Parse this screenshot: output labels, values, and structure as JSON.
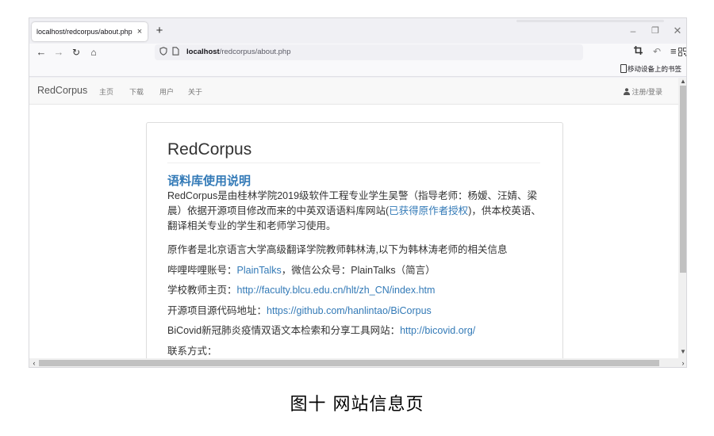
{
  "browser": {
    "tab_title": "localhost/redcorpus/about.php",
    "tab_close": "×",
    "new_tab": "+",
    "window_controls": {
      "minimize": "–",
      "maximize": "❐",
      "close": "✕"
    },
    "nav": {
      "back": "←",
      "forward": "→",
      "reload": "↻",
      "home": "⌂"
    },
    "url": {
      "host": "localhost",
      "path": "/redcorpus/about.php",
      "shield_icon": "shield-icon",
      "page_icon": "page-icon"
    },
    "toolbar_icons": {
      "qr": "qr-code-icon",
      "star": "star-icon",
      "crop": "crop-icon",
      "undo": "undo-icon",
      "menu": "menu-icon"
    },
    "bookmark_mobile": "移动设备上的书签"
  },
  "site": {
    "brand": "RedCorpus",
    "nav": {
      "home": "主页",
      "download": "下载",
      "user": "用户",
      "about": "关于"
    },
    "login": "注册/登录",
    "login_icon": "user-icon"
  },
  "content": {
    "title": "RedCorpus",
    "section_heading": "语料库使用说明",
    "intro_before": "RedCorpus是由桂林学院2019级软件工程专业学生吴警（指导老师：杨嫒、汪婧、梁晨）依据开源项目修改而来的中英双语语料库网站(",
    "intro_link": "已获得原作者授权",
    "intro_after": ")，供本校英语、翻译相关专业的学生和老师学习使用。",
    "author": "原作者是北京语言大学高级翻译学院教师韩林涛,以下为韩林涛老师的相关信息",
    "bili_label": "哔哩哔哩账号：",
    "bili_link": "PlainTalks",
    "bili_after": "，微信公众号：PlainTalks（简言）",
    "teacher_label": "学校教师主页：",
    "teacher_link": "http://faculty.blcu.edu.cn/hlt/zh_CN/index.htm",
    "repo_label": "开源项目源代码地址：",
    "repo_link": "https://github.com/hanlintao/BiCorpus",
    "bicovid_label": "BiCovid新冠肺炎疫情双语文本检索和分享工具网站：",
    "bicovid_link": "http://bicovid.org/",
    "contact": "联系方式："
  },
  "caption": "图十  网站信息页",
  "colors": {
    "link": "#337ab7",
    "navbar_bg": "#f8f8f8",
    "chrome_bg": "#f0f0f4"
  }
}
